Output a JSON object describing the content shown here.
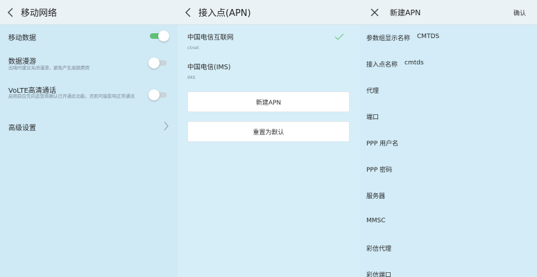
{
  "mobile_network": {
    "title": "移动网络",
    "items": [
      {
        "label": "移动数据",
        "subtitle": "",
        "toggle": "on"
      },
      {
        "label": "数据漫游",
        "subtitle": "出境时建议关闭漫游，避免产生高额费用",
        "toggle": "off"
      },
      {
        "label": "VoLTE高清通话",
        "subtitle": "启用前应先向运营商确认已开通此功能，否则可能影响正常通话",
        "toggle": "off"
      },
      {
        "label": "高级设置",
        "subtitle": "",
        "toggle": ""
      }
    ]
  },
  "apn": {
    "title": "接入点(APN)",
    "items": [
      {
        "name": "中国电信互联网",
        "type": "ctnet",
        "selected": true
      },
      {
        "name": "中国电信(IMS)",
        "type": "IMS",
        "selected": false
      }
    ],
    "new_button": "新建APN",
    "reset_button": "重置为默认"
  },
  "new_apn": {
    "title": "新建APN",
    "confirm": "确认",
    "fields": [
      {
        "label": "参数组显示名称",
        "value": "CMTDS"
      },
      {
        "label": "接入点名称",
        "value": "cmtds"
      },
      {
        "label": "代理",
        "value": ""
      },
      {
        "label": "端口",
        "value": ""
      },
      {
        "label": "PPP 用户名",
        "value": ""
      },
      {
        "label": "PPP 密码",
        "value": ""
      },
      {
        "label": "服务器",
        "value": ""
      },
      {
        "label": "MMSC",
        "value": ""
      },
      {
        "label": "彩信代理",
        "value": ""
      },
      {
        "label": "彩信端口",
        "value": ""
      }
    ]
  },
  "colors": {
    "accent_on": "#5fbf75",
    "check": "#7fcf94"
  }
}
